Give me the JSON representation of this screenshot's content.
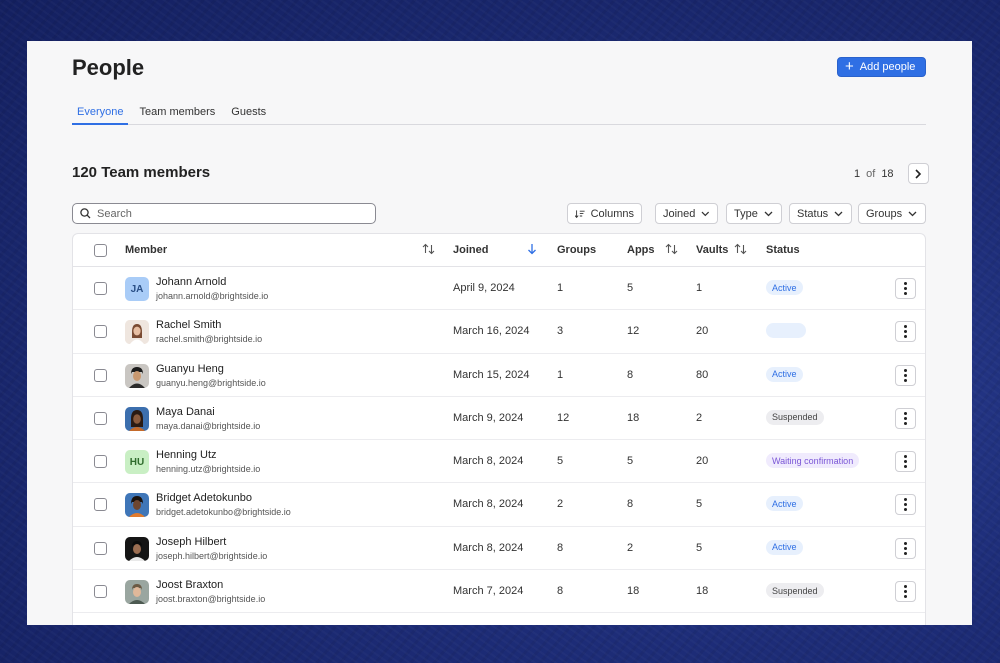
{
  "header": {
    "title": "People",
    "add_button_label": "Add people"
  },
  "tabs": [
    {
      "label": "Everyone",
      "active": true
    },
    {
      "label": "Team members",
      "active": false
    },
    {
      "label": "Guests",
      "active": false
    }
  ],
  "section": {
    "title": "120 Team members"
  },
  "pagination": {
    "current": "1",
    "of_label": "of",
    "total": "18"
  },
  "search": {
    "placeholder": "Search",
    "value": ""
  },
  "filters": {
    "columns_label": "Columns",
    "joined_label": "Joined",
    "type_label": "Type",
    "status_label": "Status",
    "groups_label": "Groups"
  },
  "table": {
    "headers": {
      "member": "Member",
      "joined": "Joined",
      "groups": "Groups",
      "apps": "Apps",
      "vaults": "Vaults",
      "status": "Status"
    },
    "rows": [
      {
        "name": "Johann Arnold",
        "email": "johann.arnold@brightside.io",
        "avatar": "JA",
        "joined": "April 9, 2024",
        "groups": "1",
        "apps": "5",
        "vaults": "1",
        "status": "Active"
      },
      {
        "name": "Rachel Smith",
        "email": "rachel.smith@brightside.io",
        "avatar": "",
        "joined": "March 16, 2024",
        "groups": "3",
        "apps": "12",
        "vaults": "20",
        "status": ""
      },
      {
        "name": "Guanyu Heng",
        "email": "guanyu.heng@brightside.io",
        "avatar": "",
        "joined": "March 15, 2024",
        "groups": "1",
        "apps": "8",
        "vaults": "80",
        "status": "Active"
      },
      {
        "name": "Maya Danai",
        "email": "maya.danai@brightside.io",
        "avatar": "",
        "joined": "March 9, 2024",
        "groups": "12",
        "apps": "18",
        "vaults": "2",
        "status": "Suspended"
      },
      {
        "name": "Henning Utz",
        "email": "henning.utz@brightside.io",
        "avatar": "HU",
        "joined": "March 8, 2024",
        "groups": "5",
        "apps": "5",
        "vaults": "20",
        "status": "Waiting confirmation"
      },
      {
        "name": "Bridget Adetokunbo",
        "email": "bridget.adetokunbo@brightside.io",
        "avatar": "",
        "joined": "March 8, 2024",
        "groups": "2",
        "apps": "8",
        "vaults": "5",
        "status": "Active"
      },
      {
        "name": "Joseph Hilbert",
        "email": "joseph.hilbert@brightside.io",
        "avatar": "",
        "joined": "March 8, 2024",
        "groups": "8",
        "apps": "2",
        "vaults": "5",
        "status": "Active"
      },
      {
        "name": "Joost Braxton",
        "email": "joost.braxton@brightside.io",
        "avatar": "",
        "joined": "March 7, 2024",
        "groups": "8",
        "apps": "18",
        "vaults": "18",
        "status": "Suspended"
      }
    ]
  },
  "colors": {
    "accent": "#2f6fe4",
    "background": "#1d2c77",
    "card": "#f7f7f8"
  }
}
